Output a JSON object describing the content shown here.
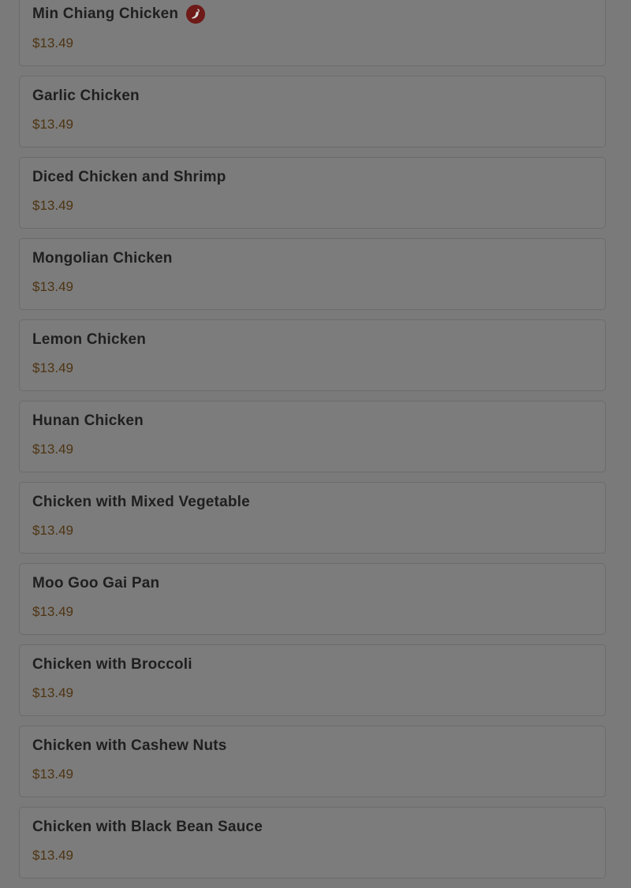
{
  "menu": {
    "items": [
      {
        "name": "Min Chiang Chicken",
        "price": "$13.49",
        "spicy": true
      },
      {
        "name": "Garlic Chicken",
        "price": "$13.49",
        "spicy": false
      },
      {
        "name": "Diced Chicken and Shrimp",
        "price": "$13.49",
        "spicy": false
      },
      {
        "name": "Mongolian Chicken",
        "price": "$13.49",
        "spicy": false
      },
      {
        "name": "Lemon Chicken",
        "price": "$13.49",
        "spicy": false
      },
      {
        "name": "Hunan Chicken",
        "price": "$13.49",
        "spicy": false
      },
      {
        "name": "Chicken with Mixed Vegetable",
        "price": "$13.49",
        "spicy": false
      },
      {
        "name": "Moo Goo Gai Pan",
        "price": "$13.49",
        "spicy": false
      },
      {
        "name": "Chicken with Broccoli",
        "price": "$13.49",
        "spicy": false
      },
      {
        "name": "Chicken with Cashew Nuts",
        "price": "$13.49",
        "spicy": false
      },
      {
        "name": "Chicken with Black Bean Sauce",
        "price": "$13.49",
        "spicy": false
      }
    ]
  },
  "icons": {
    "spicy": "chili-pepper-icon"
  },
  "colors": {
    "overlay_background": "#7a7a7a",
    "price_text": "#4e3412",
    "spicy_badge": "#6e1a18"
  }
}
